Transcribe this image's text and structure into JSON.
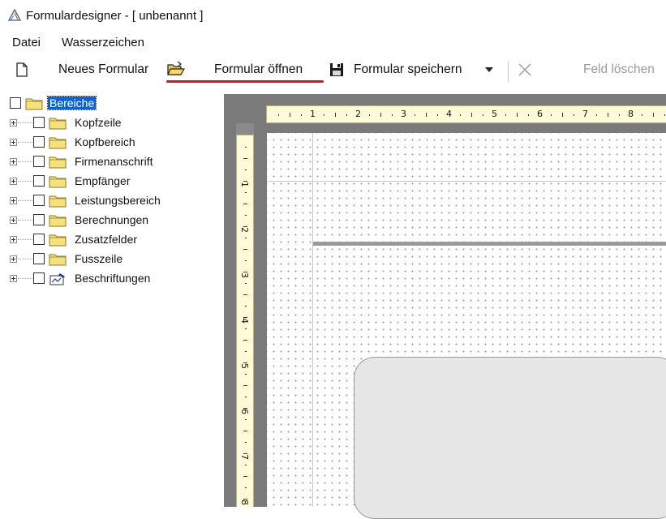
{
  "window": {
    "title": "Formulardesigner - [ unbenannt ]"
  },
  "menu": {
    "items": [
      "Datei",
      "Wasserzeichen"
    ]
  },
  "toolbar": {
    "new_label": "Neues Formular",
    "open_label": "Formular öffnen",
    "save_label": "Formular speichern",
    "delete_label": "Feld löschen"
  },
  "tree": {
    "root": "Bereiche",
    "items": [
      "Kopfzeile",
      "Kopfbereich",
      "Firmenanschrift",
      "Empfänger",
      "Leistungsbereich",
      "Berechnungen",
      "Zusatzfelder",
      "Fusszeile",
      "Beschriftungen"
    ]
  },
  "ruler": {
    "horizontal": [
      "1",
      "2",
      "3",
      "4",
      "5",
      "6",
      "7",
      "8"
    ],
    "vertical": [
      "1",
      "2",
      "3",
      "4",
      "5",
      "6",
      "7",
      "8"
    ]
  },
  "colors": {
    "accent_underline": "#d8141b",
    "selection": "#0a64d8",
    "ruler_bg": "#fffbd8",
    "canvas_bg": "#7a7a7a"
  }
}
